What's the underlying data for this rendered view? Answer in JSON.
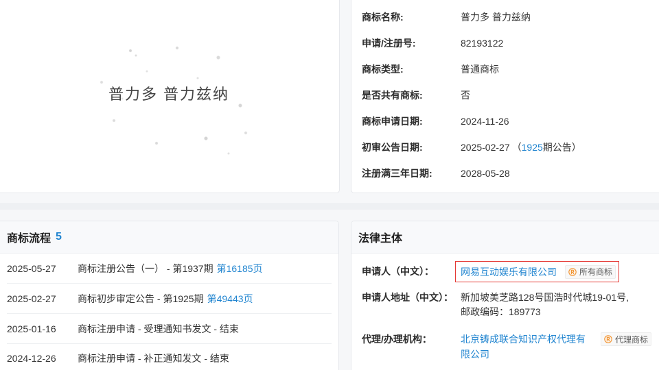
{
  "colors": {
    "link": "#2185d0",
    "accent": "#f0922f",
    "highlight_border": "#e53935"
  },
  "icons": {
    "registered_badge": "registered-trademark-icon"
  },
  "trademark_image": {
    "wordmark": "普力多 普力兹纳"
  },
  "basic_info": [
    {
      "label": "商标名称:",
      "value": "普力多 普力兹纳"
    },
    {
      "label": "申请/注册号:",
      "value": "82193122"
    },
    {
      "label": "商标类型:",
      "value": "普通商标"
    },
    {
      "label": "是否共有商标:",
      "value": "否"
    },
    {
      "label": "商标申请日期:",
      "value": "2024-11-26"
    },
    {
      "label": "初审公告日期:",
      "value": "2025-02-27",
      "note_open": "（",
      "note_link": "1925",
      "note_close": "期公告）"
    },
    {
      "label": "注册满三年日期:",
      "value": "2028-05-28"
    }
  ],
  "process": {
    "title": "商标流程",
    "count": "5",
    "items": [
      {
        "date": "2025-05-27",
        "desc": "商标注册公告（一） - 第1937期",
        "link": "第16185页"
      },
      {
        "date": "2025-02-27",
        "desc": "商标初步审定公告 - 第1925期",
        "link": "第49443页"
      },
      {
        "date": "2025-01-16",
        "desc": "商标注册申请 - 受理通知书发文 - 结束"
      },
      {
        "date": "2024-12-26",
        "desc": "商标注册申请 - 补正通知发文 - 结束"
      }
    ]
  },
  "legal": {
    "title": "法律主体",
    "applicant": {
      "label": "申请人（中文）：",
      "name": "网易互动娱乐有限公司",
      "badge_label": "所有商标"
    },
    "address": {
      "label": "申请人地址（中文）：",
      "lines": [
        "新加坡美芝路128号国浩时代城19-01号,",
        "邮政编码：189773"
      ]
    },
    "agency": {
      "label": "代理/办理机构：",
      "name": "北京铸成联合知识产权代理有限公司",
      "badge_label": "代理商标"
    }
  }
}
